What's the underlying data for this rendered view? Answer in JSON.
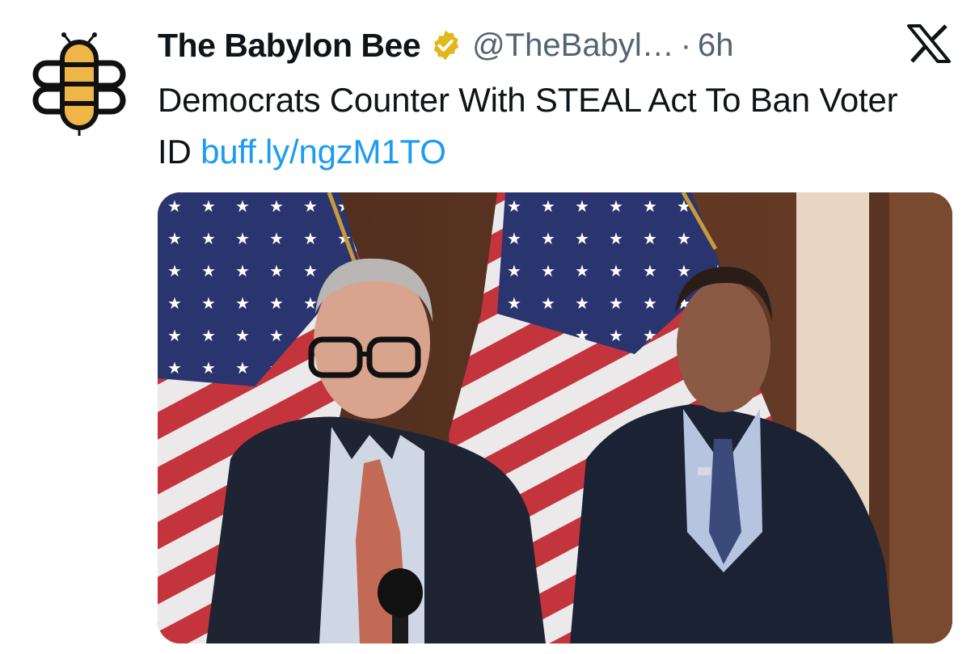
{
  "tweet": {
    "author": {
      "display_name": "The Babylon Bee",
      "handle": "@TheBabyl…",
      "verified": true,
      "avatar_icon": "babylon-bee-logo"
    },
    "separator": "·",
    "time": "6h",
    "text_before_link": "Democrats Counter With STEAL Act To Ban Voter ID ",
    "link": "buff.ly/ngzM1TO",
    "platform_icon": "x-logo-icon",
    "media": {
      "kind": "photo"
    }
  },
  "colors": {
    "link": "#1d9bf0",
    "secondary_text": "#536471",
    "verified_badge": "#e2b719",
    "bee_yellow": "#f0b547"
  }
}
